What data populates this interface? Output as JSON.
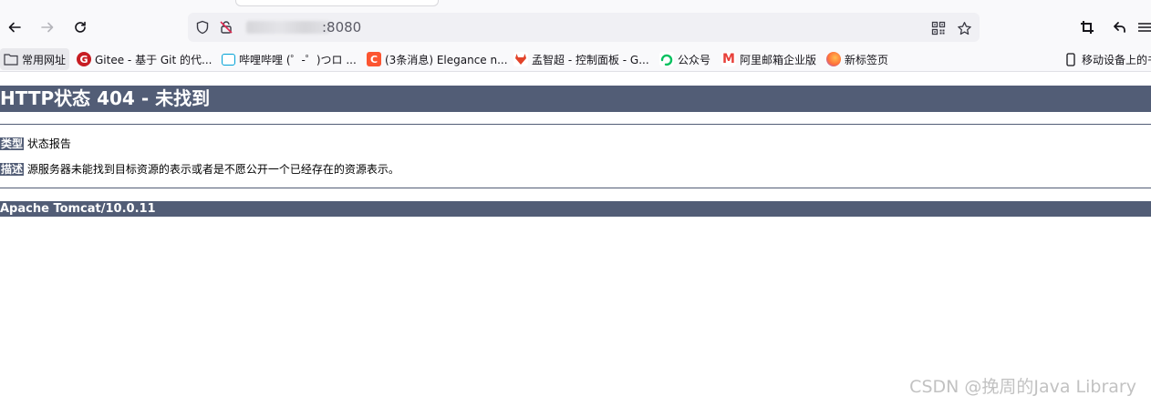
{
  "browser": {
    "url_suffix": ":8080",
    "bookmarks": [
      {
        "label": "常用网址",
        "icon": "folder-icon",
        "color": "#5b5b66"
      },
      {
        "label": "Gitee - 基于 Git 的代...",
        "icon": "gitee-icon",
        "color": "#c71d23"
      },
      {
        "label": "哔哩哔哩 (゜-゜)つロ ...",
        "icon": "bilibili-icon",
        "color": "#00a1d6"
      },
      {
        "label": "(3条消息) Elegance n...",
        "icon": "csdn-icon",
        "color": "#fc5531"
      },
      {
        "label": "孟智超 - 控制面板 - G...",
        "icon": "gitlab-icon",
        "color": "#e24329"
      },
      {
        "label": "公众号",
        "icon": "wechat-icon",
        "color": "#07c160"
      },
      {
        "label": "阿里邮箱企业版",
        "icon": "mail-icon",
        "color": "#e8403a"
      },
      {
        "label": "新标签页",
        "icon": "firefox-icon",
        "color": "#ff7139"
      }
    ],
    "mobile_bookmarks": "移动设备上的书"
  },
  "page": {
    "title": "HTTP状态 404 - 未找到",
    "type_label": "类型",
    "type_value": "状态报告",
    "desc_label": "描述",
    "desc_value": "源服务器未能找到目标资源的表示或者是不愿公开一个已经存在的资源表示。",
    "server": "Apache Tomcat/10.0.11"
  },
  "watermark": "CSDN @挽周的Java Library",
  "colors": {
    "tomcat_bar": "#525d76"
  }
}
